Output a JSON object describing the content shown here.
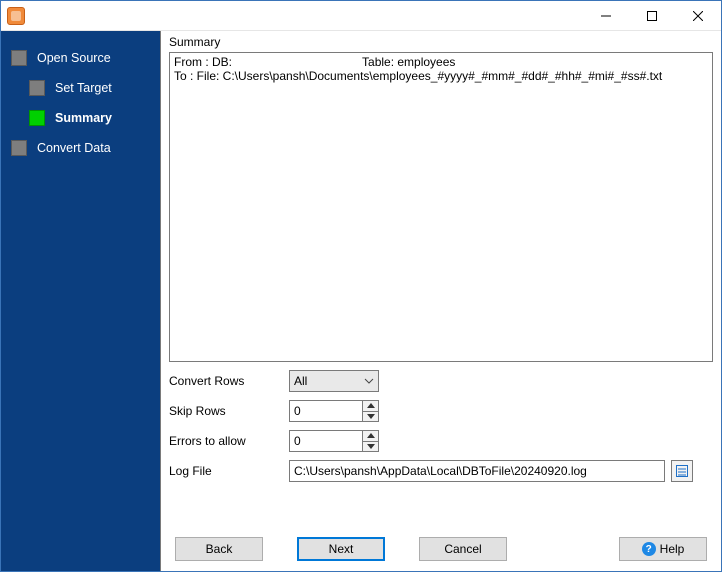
{
  "sidebar": {
    "items": [
      {
        "label": "Open Source"
      },
      {
        "label": "Set Target"
      },
      {
        "label": "Summary"
      },
      {
        "label": "Convert Data"
      }
    ]
  },
  "panel": {
    "title": "Summary",
    "line1_prefix": "From : DB:",
    "line1_table": "Table: employees",
    "line2": "To : File: C:\\Users\\pansh\\Documents\\employees_#yyyy#_#mm#_#dd#_#hh#_#mi#_#ss#.txt"
  },
  "form": {
    "convert_rows_label": "Convert Rows",
    "convert_rows_value": "All",
    "skip_rows_label": "Skip Rows",
    "skip_rows_value": "0",
    "errors_label": "Errors to allow",
    "errors_value": "0",
    "log_file_label": "Log File",
    "log_file_value": "C:\\Users\\pansh\\AppData\\Local\\DBToFile\\20240920.log"
  },
  "buttons": {
    "back": "Back",
    "next": "Next",
    "cancel": "Cancel",
    "help": "Help"
  }
}
